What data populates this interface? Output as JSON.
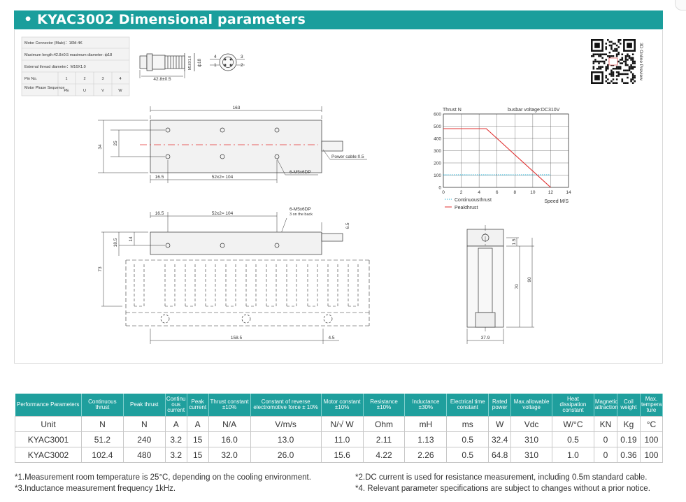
{
  "section_title": "KYAC3002 Dimensional parameters",
  "connector": {
    "row1": "Motor Connector (Male)：16M-4K",
    "row2": "Maximum length:42.8±0.5   maximum diameter: ф18",
    "row3": "External thread diameter：M16X1.0",
    "pin_label": "Pin No.",
    "pins": [
      "1",
      "2",
      "3",
      "4"
    ],
    "phase_label": "Motor Phase Sequence",
    "phases": [
      "PE",
      "U",
      "V",
      "W"
    ],
    "dim_length": "42.8±0.5",
    "dim_thread": "M16X1.0",
    "dim_diameter": "ф18",
    "pin_n1": "1",
    "pin_n2": "2",
    "pin_n3": "3",
    "pin_n4": "4"
  },
  "qr": {
    "caption": "3D Online Preview"
  },
  "top_view": {
    "dim_163": "163",
    "dim_34": "34",
    "dim_25": "25",
    "dim_165": "16.5",
    "dim_104": "52x2= 104",
    "holes": "6-M5x6DP",
    "cable": "Power cable:0.5"
  },
  "front_view": {
    "dim_165": "16.5",
    "dim_104": "52x2= 104",
    "holes": "6-M5x6DP",
    "holes_note": "3 on the back",
    "dim_65": "6.5",
    "dim_185": "18.5",
    "dim_14": "14",
    "dim_73": "73",
    "dim_1585": "158.5",
    "dim_45": "4.5"
  },
  "side_view": {
    "dim_15": "1.5",
    "dim_70": "70",
    "dim_90": "90",
    "dim_379": "37.9"
  },
  "chart_data": {
    "type": "line",
    "ylabel": "Thrust N",
    "xlabel": "Speed M/S",
    "annotation": "busbar voltage:DC310V",
    "xlim": [
      0,
      14
    ],
    "ylim": [
      0,
      600
    ],
    "x_ticks": [
      0,
      2,
      4,
      6,
      8,
      10,
      12,
      14
    ],
    "y_ticks": [
      0,
      100,
      200,
      300,
      400,
      500,
      600
    ],
    "grid": true,
    "legend_position": "bottom-left",
    "series": [
      {
        "name": "Continuousthrust",
        "color": "#2ab1d6",
        "style": "dotted",
        "x": [
          0,
          12
        ],
        "y": [
          102.4,
          102.4
        ]
      },
      {
        "name": "Peakthrust",
        "color": "#e03030",
        "style": "solid",
        "x": [
          0,
          4.8,
          12
        ],
        "y": [
          480,
          480,
          0
        ]
      }
    ]
  },
  "table": {
    "headers": [
      "Performance Parameters",
      "Continuous thrust",
      "Peak thrust",
      "Continu ous current",
      "Peak current",
      "Thrust constant ±10%",
      "Constant of reverse electromotive force ± 10%",
      "Motor constant ±10%",
      "Resistance ±10%",
      "Inductance ±30%",
      "Electrical time constant",
      "Rated power",
      "Max.allowable voltage",
      "Heat dissipation constant",
      "Magnetic attraction",
      "Coil weight",
      "Max. tempera ture"
    ],
    "rows": [
      [
        "Unit",
        "N",
        "N",
        "A",
        "A",
        "N/A",
        "V/m/s",
        "N/√ W",
        "Ohm",
        "mH",
        "ms",
        "W",
        "Vdc",
        "W/°C",
        "KN",
        "Kg",
        "°C"
      ],
      [
        "KYAC3001",
        "51.2",
        "240",
        "3.2",
        "15",
        "16.0",
        "13.0",
        "11.0",
        "2.11",
        "1.13",
        "0.5",
        "32.4",
        "310",
        "0.5",
        "0",
        "0.19",
        "100"
      ],
      [
        "KYAC3002",
        "102.4",
        "480",
        "3.2",
        "15",
        "32.0",
        "26.0",
        "15.6",
        "4.22",
        "2.26",
        "0.5",
        "64.8",
        "310",
        "1.0",
        "0",
        "0.36",
        "100"
      ]
    ]
  },
  "notes": {
    "n1": "*1.Measurement room temperature is 25°C, depending on the cooling environment.",
    "n2": "*2.DC current is used for resistance measurement, including 0.5m standard cable.",
    "n3": "*3.Inductance measurement frequency 1kHz.",
    "n4": "*4. Relevant parameter specifications are subject to changes without a prior notice."
  }
}
